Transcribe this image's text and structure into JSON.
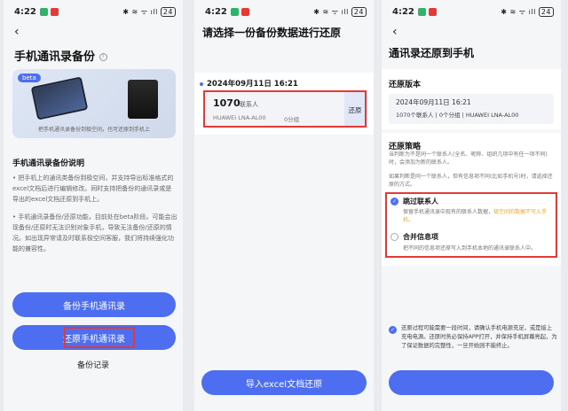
{
  "status": {
    "time": "4:22",
    "signal_text": "✱ ≋ ᯤ ıll",
    "battery": "24"
  },
  "screen1": {
    "title": "手机通讯录备份",
    "info_icon": "info-icon",
    "badge": "beta",
    "banner_caption": "把手机通讯录备份到极空间，也可还原到手机上",
    "section_title": "手机通讯录备份说明",
    "paragraph1": "• 把手机上的通讯类备份到极空间，并支持导出标准格式的excel文档后进行编辑修改。同时支持把备份的通讯录或是导出的excel文档还原到手机上。",
    "paragraph2": "• 手机通讯录备份/还原功能，目前处在beta阶段。可能会出现备份/还原时无法识别对象手机，导致无法备份/还原的情况。如出现异常请及时联系极空间客服，我们将持续强化功能的兼容性。",
    "backup_button": "备份手机通讯录",
    "restore_button": "还原手机通讯录",
    "records_link": "备份记录"
  },
  "screen2": {
    "title": "请选择一份备份数据进行还原",
    "date_header": "2024年09月11日 16:21",
    "count": "1070",
    "count_unit": "联系人",
    "device": "HUAWEI LNA-AL00",
    "groups": "0分组",
    "restore_label": "还原",
    "import_button": "导入excel文档还原"
  },
  "screen3": {
    "title": "通讯录还原到手机",
    "version_label": "还原版本",
    "version_date": "2024年09月11日 16:21",
    "version_detail": "1070个联系人 | 0个分组 | HUAWEI LNA-AL00",
    "strategy_label": "还原策略",
    "strategy_desc": "当判断为不是同一个联系人(全名、昵称、组织几项中有任一项不同)时，会添加为新的联系人。",
    "strategy_desc2": "如果判断是同一个联系人，但有信息项不同(比如手机号)时，请选择还原的方式。",
    "option1_title": "跳过联系人",
    "option1_desc_a": "保留手机通讯录中现有的联系人数据，",
    "option1_desc_b": "极空间的数据不写入手机。",
    "option2_title": "合并信息项",
    "option2_desc": "把不同的信息项还原写入到手机本地的通讯录联系人中。",
    "notice": "还原过程可能需要一段时间，请确认手机电源充足，或是接上充电电源。还原时务必保持APP打开，并保持手机屏幕亮起，为了保证数据的完整性，一旦开始则不能终止。",
    "accent": "#4e6ef2",
    "warn": "#f5a623"
  }
}
